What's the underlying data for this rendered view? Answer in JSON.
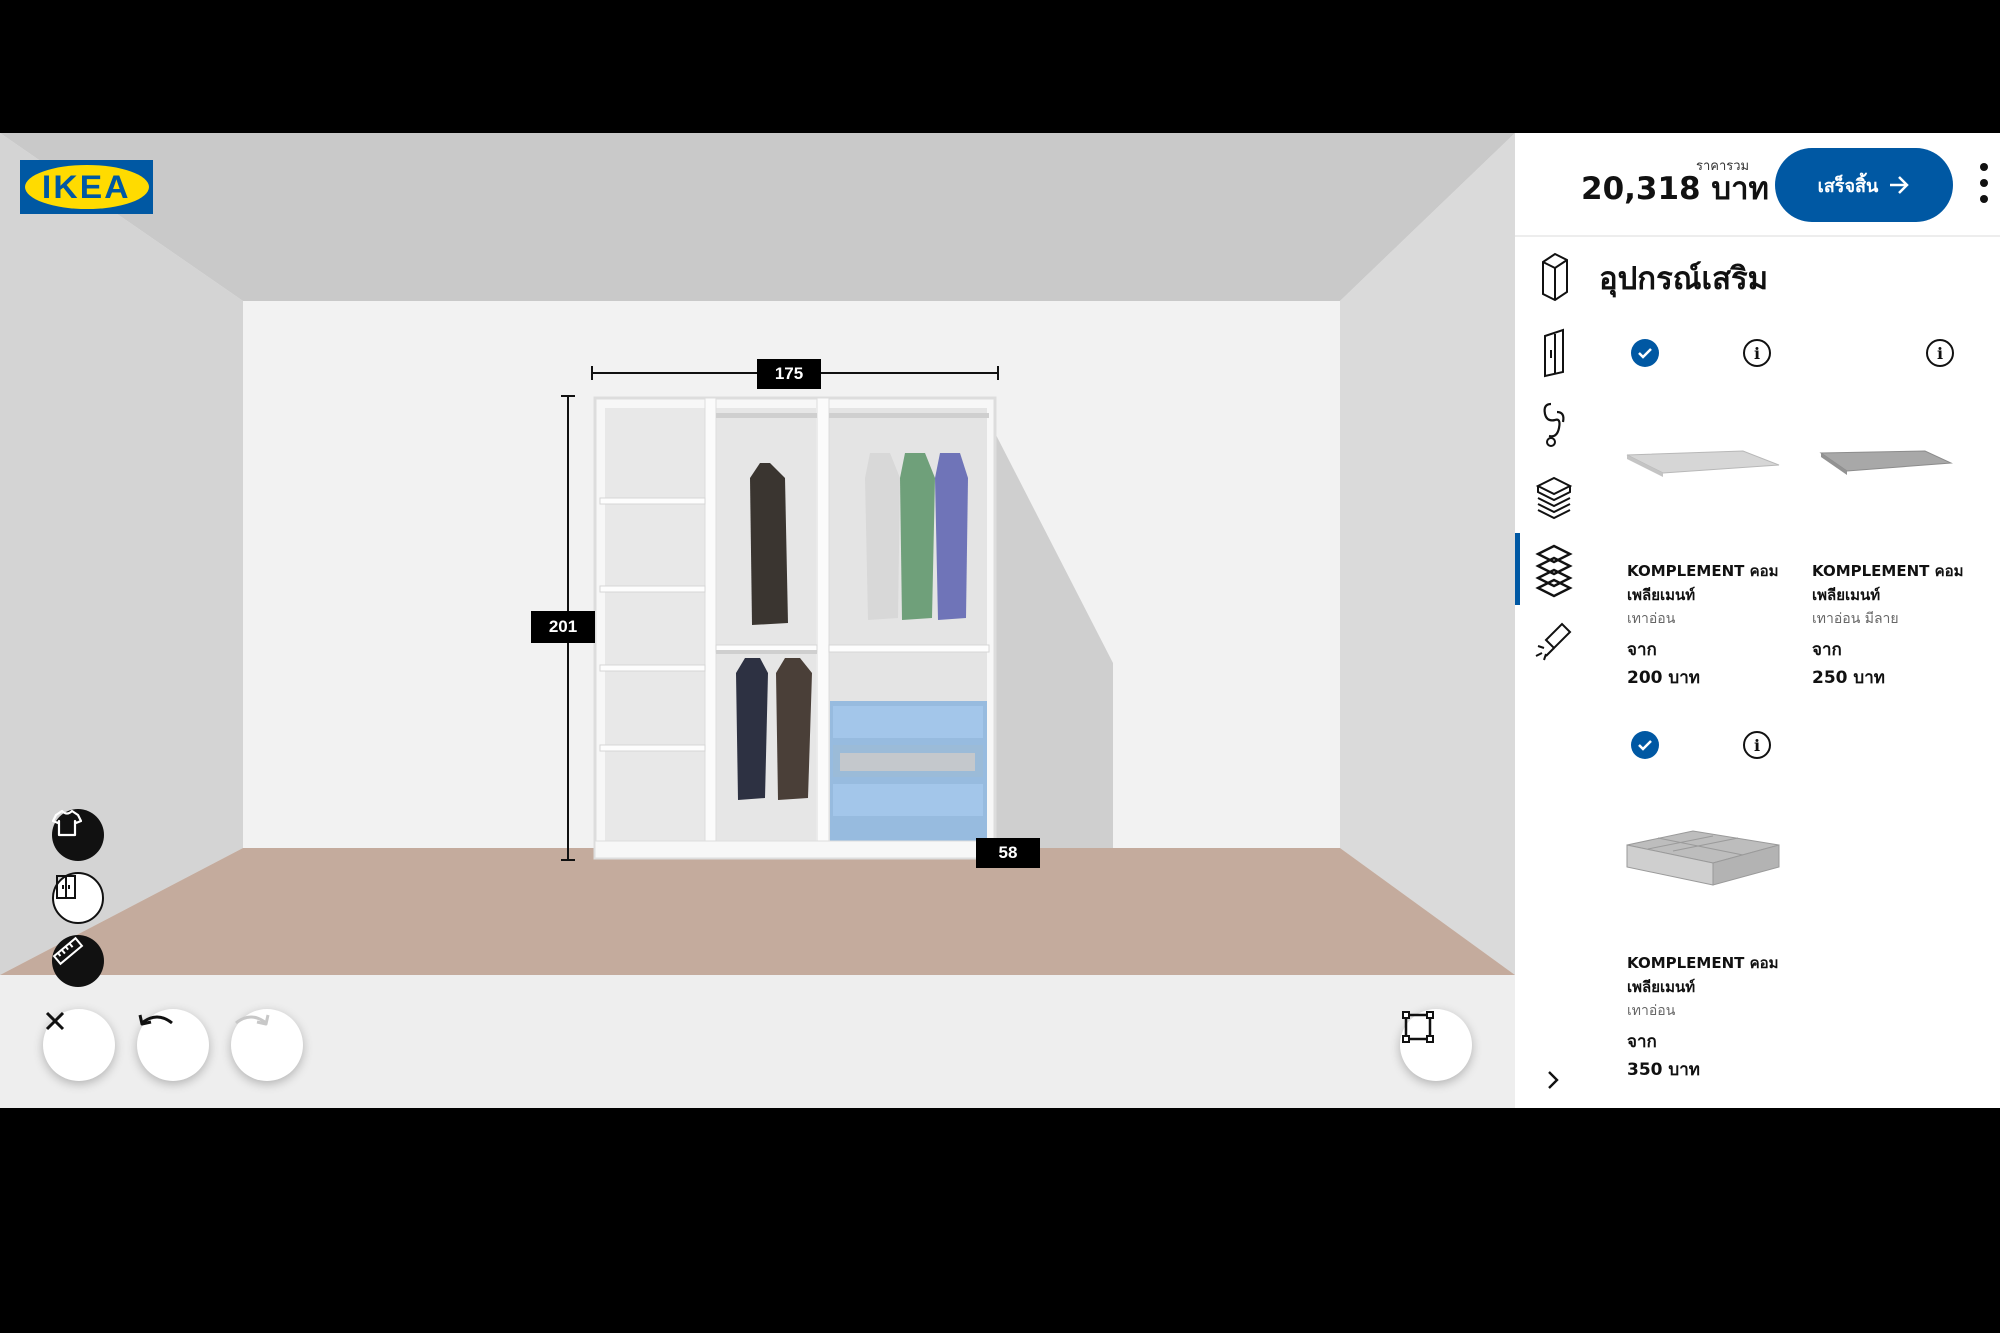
{
  "brand": {
    "logo_text": "IKEA"
  },
  "scene": {
    "dimensions": {
      "width": "175",
      "height": "201",
      "depth": "58"
    },
    "wall_color": "#f2f2f2",
    "floor_color": "#c4ab9d"
  },
  "tools": {
    "clothes_icon": "shirt-icon",
    "doors_icon": "doors-icon",
    "measure_icon": "ruler-icon",
    "close_icon": "close-icon",
    "undo_icon": "undo-icon",
    "redo_icon": "redo-icon",
    "fullscreen_icon": "fullscreen-icon"
  },
  "header": {
    "price_caption": "ราคารวม",
    "price": "20,318 บาท",
    "finish_label": "เสร็จสิ้น",
    "finish_color": "#0058a3"
  },
  "panel": {
    "title": "อุปกรณ์เสริม",
    "tabs": [
      {
        "icon": "frame-icon"
      },
      {
        "icon": "door-icon"
      },
      {
        "icon": "hooks-icon"
      },
      {
        "icon": "shelves-icon"
      },
      {
        "icon": "accessories-icon",
        "active": true
      },
      {
        "icon": "lighting-icon"
      }
    ],
    "products": [
      {
        "name_line1": "KOMPLEMENT คอม",
        "name_line2": "เพลียเมนท์",
        "variant": "เทาอ่อน",
        "from": "จาก",
        "price": "200 บาท",
        "selected": true
      },
      {
        "name_line1": "KOMPLEMENT คอม",
        "name_line2": "เพลียเมนท์",
        "variant": "เทาอ่อน มีลาย",
        "from": "จาก",
        "price": "250 บาท",
        "selected": false
      },
      {
        "name_line1": "KOMPLEMENT คอม",
        "name_line2": "เพลียเมนท์",
        "variant": "เทาอ่อน",
        "from": "จาก",
        "price": "350 บาท",
        "selected": true
      }
    ]
  }
}
